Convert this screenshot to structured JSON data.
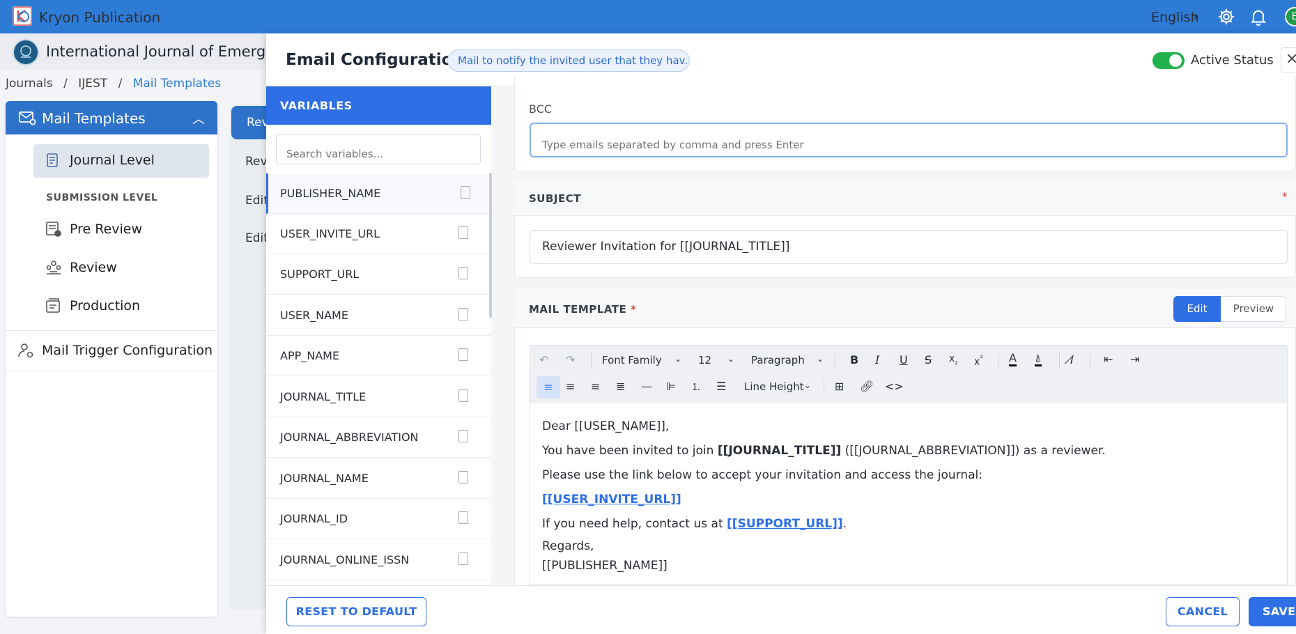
{
  "topbar": {
    "app_title": "Kryon Publication",
    "language": "English",
    "avatar_initial": "E",
    "brand_color": "#2e7bd6"
  },
  "journal": {
    "name": "International Journal of Emerging"
  },
  "breadcrumb": {
    "items": [
      "Journals",
      "IJEST",
      "Mail Templates"
    ],
    "separator": "/"
  },
  "sidebar": {
    "header": "Mail Templates",
    "journal_level": "Journal Level",
    "submission_level_label": "SUBMISSION LEVEL",
    "submission_items": [
      "Pre Review",
      "Review",
      "Production"
    ],
    "mail_trigger": "Mail Trigger Configuration"
  },
  "mid_tabs": [
    "Rev",
    "Rev",
    "Edit",
    "Edit"
  ],
  "modal": {
    "title": "Email Configuration",
    "chip": "Mail to notify the invited user that they hav...",
    "active_status_label": "Active Status",
    "active_status": true,
    "close": "✕"
  },
  "variables": {
    "header": "VARIABLES",
    "search_placeholder": "Search variables...",
    "items": [
      "PUBLISHER_NAME",
      "USER_INVITE_URL",
      "SUPPORT_URL",
      "USER_NAME",
      "APP_NAME",
      "JOURNAL_TITLE",
      "JOURNAL_ABBREVIATION",
      "JOURNAL_NAME",
      "JOURNAL_ID",
      "JOURNAL_ONLINE_ISSN"
    ]
  },
  "bcc": {
    "label": "BCC",
    "placeholder": "Type emails separated by comma and press Enter"
  },
  "subject": {
    "label": "SUBJECT",
    "required_mark": "*",
    "value": "Reviewer Invitation for [[JOURNAL_TITLE]]"
  },
  "mail_template": {
    "label": "MAIL TEMPLATE",
    "required_mark": "*",
    "edit_label": "Edit",
    "preview_label": "Preview",
    "toolbar": {
      "font_family": "Font Family",
      "font_size": "12",
      "block": "Paragraph",
      "line_height": "Line Height"
    },
    "body": {
      "line1": "Dear [[USER_NAME]],",
      "line2_a": "You have been invited to join ",
      "line2_b": "[[JOURNAL_TITLE]]",
      "line2_c": " ([[JOURNAL_ABBREVIATION]]) as a reviewer.",
      "line3": "Please use the link below to accept your invitation and access the journal:",
      "line4": "[[USER_INVITE_URL]]",
      "line5_a": "If you need help, contact us at ",
      "line5_b": "[[SUPPORT_URL]]",
      "line5_c": ".",
      "line6": "Regards,",
      "line7": "[[PUBLISHER_NAME]]"
    }
  },
  "footer": {
    "reset": "RESET TO DEFAULT",
    "cancel": "CANCEL",
    "save": "SAVE"
  }
}
